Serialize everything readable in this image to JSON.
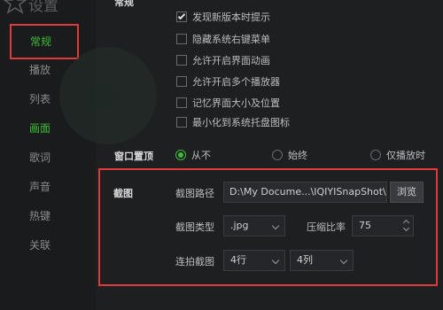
{
  "window": {
    "title": "设置"
  },
  "sidebar": {
    "items": [
      {
        "label": "常规",
        "active": true
      },
      {
        "label": "播放"
      },
      {
        "label": "列表"
      },
      {
        "label": "画面",
        "active": true
      },
      {
        "label": "歌词"
      },
      {
        "label": "声音"
      },
      {
        "label": "热键"
      },
      {
        "label": "关联"
      }
    ]
  },
  "general": {
    "label": "常规",
    "options": [
      {
        "label": "发现新版本时提示",
        "checked": true
      },
      {
        "label": "隐藏系统右键菜单",
        "checked": false
      },
      {
        "label": "允许开启界面动画",
        "checked": false
      },
      {
        "label": "允许开启多个播放器",
        "checked": false
      },
      {
        "label": "记忆界面大小及位置",
        "checked": false
      },
      {
        "label": "最小化到系统托盘图标",
        "checked": false
      }
    ]
  },
  "window_top": {
    "label": "窗口置顶",
    "options": [
      {
        "label": "从不",
        "selected": true
      },
      {
        "label": "始终",
        "selected": false
      },
      {
        "label": "仅播放时",
        "selected": false
      }
    ]
  },
  "screenshot": {
    "label": "截图",
    "path_label": "截图路径",
    "path_value": "D:\\My Docume...\\IQIYISnapShot\\",
    "browse_label": "浏览",
    "type_label": "截图类型",
    "type_value": ".jpg",
    "compression_label": "压缩比率",
    "compression_value": "75",
    "burst_label": "连拍截图",
    "rows_value": "4行",
    "cols_value": "4列"
  },
  "colors": {
    "accent": "#3fbb38",
    "highlight_box": "#e23a3a",
    "background": "#1e1f21"
  }
}
